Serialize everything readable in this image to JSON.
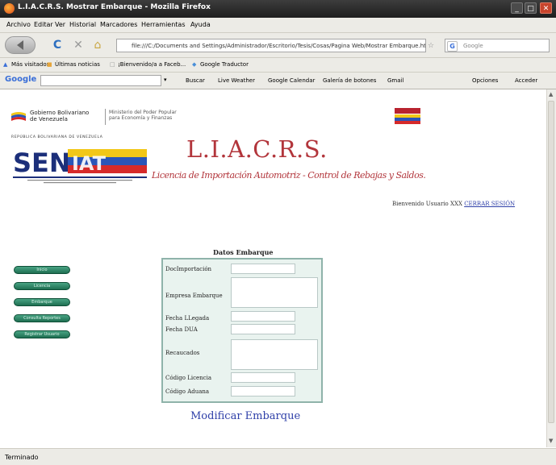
{
  "window": {
    "title": "L.I.A.C.R.S. Mostrar Embarque - Mozilla Firefox",
    "minimize": "_",
    "maximize": "□",
    "close": "✕"
  },
  "menu": [
    "Archivo",
    "Editar",
    "Ver",
    "Historial",
    "Marcadores",
    "Herramientas",
    "Ayuda"
  ],
  "nav": {
    "reload": "C",
    "stop": "✕",
    "home": "⌂",
    "url": "file:///C:/Documents and Settings/Administrador/Escritorio/Tesis/Cosas/Pagina Web/Mostrar Embarque.html",
    "search_placeholder": "Google"
  },
  "bookmarks": [
    "Más visitados",
    "Últimas noticias",
    "¡Bienvenido/a a Faceb...",
    "Google Traductor"
  ],
  "google_toolbar": {
    "logo": "Google",
    "items": [
      "Buscar",
      "Live Weather",
      "Google Calendar",
      "Galería de botones",
      "Gmail",
      "Opciones",
      "Acceder"
    ]
  },
  "header": {
    "gov_title": "Gobierno Bolivariano",
    "gov_sub": "de Venezuela",
    "ministry_line1": "Ministerio del Poder Popular",
    "ministry_line2": "para Economía y Finanzas",
    "seniat_top": "REPÚBLICA BOLIVARIANA DE VENEZUELA",
    "seniat_name": "SENIAT",
    "app_title": "L.I.A.C.R.S.",
    "app_subtitle": "Licencia de Importación Automotriz - Control de Rebajas y Saldos.",
    "welcome": "Bienvenido Usuario XXX",
    "logout": "CERRAR SESIÓN"
  },
  "sidebar": [
    "Inicio",
    "Licencia",
    "Embarque",
    "Consulta Reportes",
    "Registrar Usuario"
  ],
  "form": {
    "title": "Datos Embarque",
    "fields": [
      {
        "label": "DocImportación",
        "value": ""
      },
      {
        "label": "Empresa Embarque",
        "value": ""
      },
      {
        "label": "Fecha LLegada",
        "value": ""
      },
      {
        "label": "Fecha DUA",
        "value": ""
      },
      {
        "label": "Recaucados",
        "value": ""
      },
      {
        "label": "Código Licencia",
        "value": ""
      },
      {
        "label": "Código Aduana",
        "value": ""
      }
    ],
    "submit": "Modificar Embarque"
  },
  "status": "Terminado",
  "colors": {
    "accent_green": "#2f8a66",
    "title_red": "#b2353b",
    "link_blue": "#2e3fa8",
    "form_border": "#8fb3aa"
  }
}
